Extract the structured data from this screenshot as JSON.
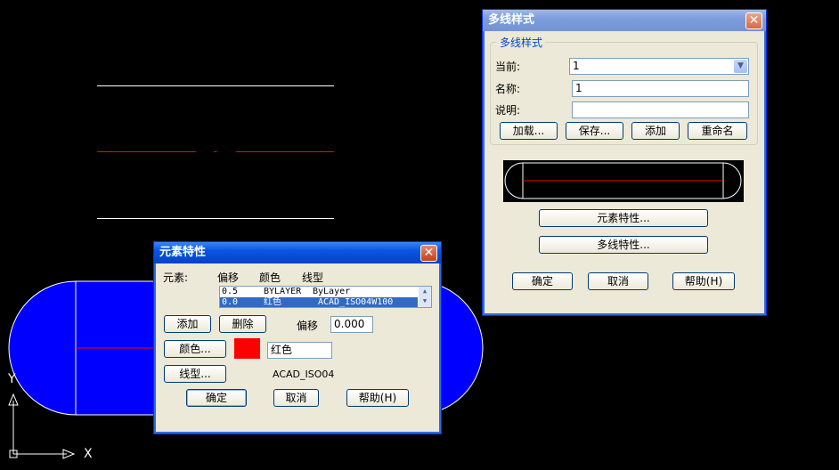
{
  "colors": {
    "cad_background": "#000000",
    "blue_shape": "#0000ff",
    "red_line": "#ff0000",
    "white_line": "#ffffff",
    "swatch_red": "#ff0000"
  },
  "cad": {
    "ucs_x_label": "X",
    "ucs_y_label": "Y"
  },
  "mline_style": {
    "title": "多线样式",
    "group_title": "多线样式",
    "current_label": "当前:",
    "current_value": "1",
    "name_label": "名称:",
    "name_value": "1",
    "desc_label": "说明:",
    "desc_value": "",
    "load_button": "加载...",
    "save_button": "保存...",
    "add_button": "添加",
    "rename_button": "重命名",
    "element_props_button": "元素特性...",
    "mline_props_button": "多线特性...",
    "ok_button": "确定",
    "cancel_button": "取消",
    "help_button": "帮助(H)",
    "close_icon": "close-icon"
  },
  "element_props": {
    "title": "元素特性",
    "elements_label": "元素:",
    "columns": [
      "偏移",
      "颜色",
      "线型"
    ],
    "rows": [
      {
        "offset": "0.5",
        "color": "BYLAYER",
        "linetype": "ByLayer",
        "selected": false
      },
      {
        "offset": "0.0",
        "color": "红色",
        "linetype": "ACAD_ISO04W100",
        "selected": true
      }
    ],
    "add_button": "添加",
    "delete_button": "删除",
    "offset_label": "偏移",
    "offset_value": "0.000",
    "color_button": "颜色...",
    "color_value": "红色",
    "linetype_button": "线型...",
    "linetype_value": "ACAD_ISO04",
    "ok_button": "确定",
    "cancel_button": "取消",
    "help_button": "帮助(H)",
    "close_icon": "close-icon"
  }
}
